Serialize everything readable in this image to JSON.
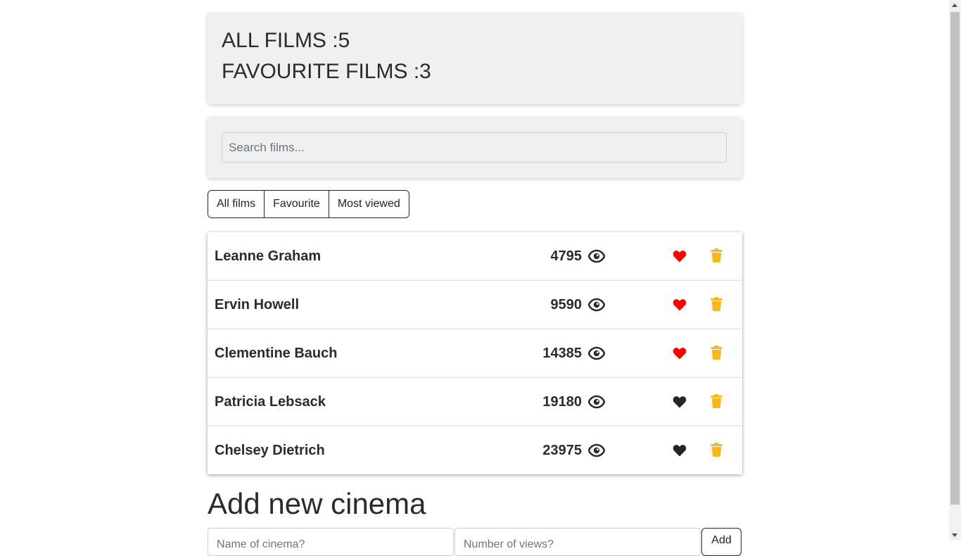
{
  "stats": {
    "all_films": "ALL FILMS :5",
    "favourite_films": "FAVOURITE FILMS :3"
  },
  "search": {
    "placeholder": "Search films...",
    "value": ""
  },
  "filters": [
    {
      "label": "All films"
    },
    {
      "label": "Favourite"
    },
    {
      "label": "Most viewed"
    }
  ],
  "films": [
    {
      "name": "Leanne Graham",
      "views": "4795",
      "favourite": true
    },
    {
      "name": "Ervin Howell",
      "views": "9590",
      "favourite": true
    },
    {
      "name": "Clementine Bauch",
      "views": "14385",
      "favourite": true
    },
    {
      "name": "Patricia Lebsack",
      "views": "19180",
      "favourite": false
    },
    {
      "name": "Chelsey Dietrich",
      "views": "23975",
      "favourite": false
    }
  ],
  "add_form": {
    "title": "Add new cinema",
    "name_placeholder": "Name of cinema?",
    "views_placeholder": "Number of views?",
    "button_label": "Add"
  },
  "colors": {
    "favourite_active": "#ff0000",
    "favourite_inactive": "#212529",
    "trash": "#f5b820",
    "card_background": "#f0f0f0"
  },
  "icons": {
    "views": "eye-icon",
    "favourite": "heart-icon",
    "delete": "trash-icon"
  }
}
